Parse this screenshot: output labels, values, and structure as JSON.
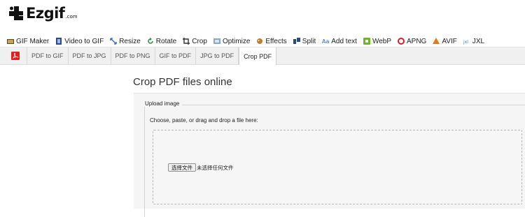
{
  "brand": {
    "name": "Ezgif",
    "suffix": ".com"
  },
  "toolbar": [
    {
      "label": "GIF Maker",
      "icon": "gif-maker-icon"
    },
    {
      "label": "Video to GIF",
      "icon": "video-icon"
    },
    {
      "label": "Resize",
      "icon": "resize-icon"
    },
    {
      "label": "Rotate",
      "icon": "rotate-icon"
    },
    {
      "label": "Crop",
      "icon": "crop-icon"
    },
    {
      "label": "Optimize",
      "icon": "optimize-icon"
    },
    {
      "label": "Effects",
      "icon": "effects-icon"
    },
    {
      "label": "Split",
      "icon": "split-icon"
    },
    {
      "label": "Add text",
      "icon": "add-text-icon"
    },
    {
      "label": "WebP",
      "icon": "webp-icon"
    },
    {
      "label": "APNG",
      "icon": "apng-icon"
    },
    {
      "label": "AVIF",
      "icon": "avif-icon"
    },
    {
      "label": "JXL",
      "icon": "jxl-icon"
    }
  ],
  "subnav": {
    "pdf_icon": "pdf-icon",
    "tabs": [
      "PDF to GIF",
      "PDF to JPG",
      "PDF to PNG",
      "GIF to PDF",
      "JPG to PDF",
      "Crop PDF"
    ],
    "active_index": 5
  },
  "main": {
    "title": "Crop PDF files online",
    "upload": {
      "legend": "Upload image",
      "instructions": "Choose, paste, or drag and drop a file here:",
      "button_label": "选择文件",
      "file_status": "未选择任何文件"
    }
  },
  "colors": {
    "pdf_red": "#e02020",
    "active_tab_bg": "#ffffff",
    "subnav_bg": "#f0f0f0"
  }
}
